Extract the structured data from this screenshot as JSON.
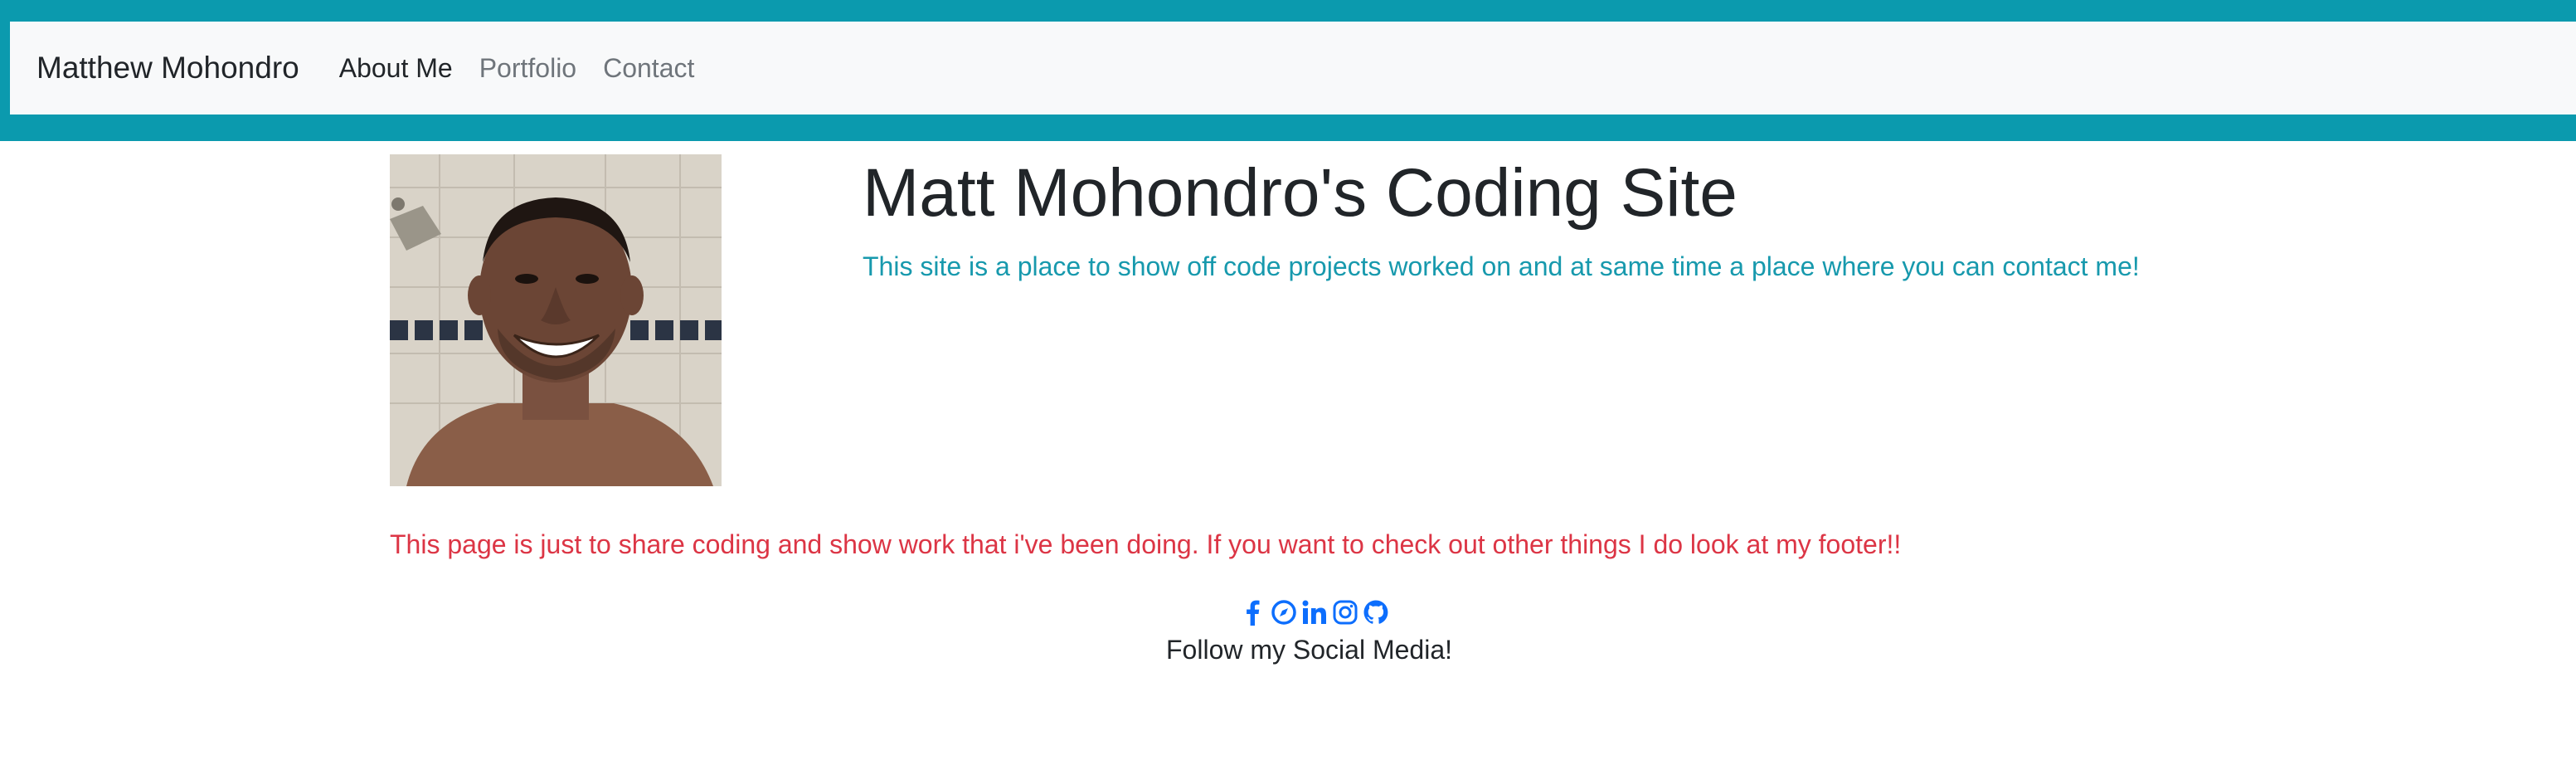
{
  "navbar": {
    "brand": "Matthew Mohondro",
    "links": [
      {
        "label": "About Me"
      },
      {
        "label": "Portfolio"
      },
      {
        "label": "Contact"
      }
    ]
  },
  "hero": {
    "title": "Matt Mohondro's Coding Site",
    "subtitle": "This site is a place to show off code projects worked on and at same time a place where you can contact me!"
  },
  "intro": {
    "text": "This page is just to share coding and show work that i've been doing. If you want to check out other things I do look at my footer!!"
  },
  "footer": {
    "social_icons": [
      "facebook-icon",
      "compass-icon",
      "linkedin-icon",
      "instagram-icon",
      "github-icon"
    ],
    "follow_text": "Follow my Social Media!"
  },
  "colors": {
    "navbar_accent": "#0b9aae",
    "navbar_bg": "#f8f9fa",
    "subtitle": "#1799ad",
    "intro": "#dc3545",
    "social_icon": "#0d6efd"
  }
}
